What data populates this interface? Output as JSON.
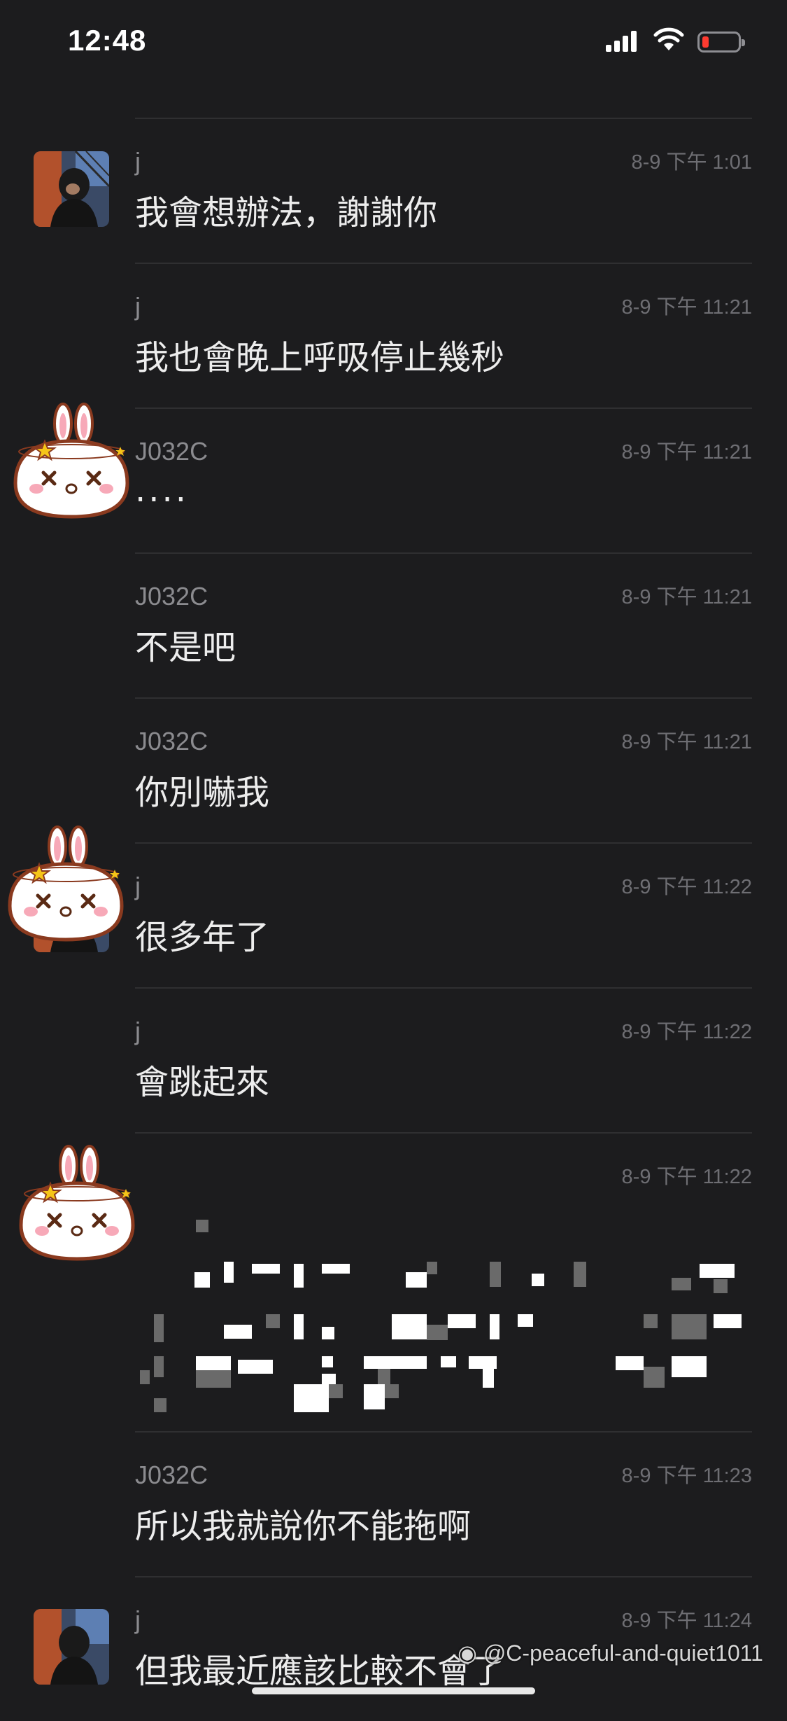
{
  "status_bar": {
    "time": "12:48",
    "battery": "low"
  },
  "messages": [
    {
      "sender": "j",
      "timestamp": "8-9 下午 1:01",
      "text": "我會想辦法，謝謝你",
      "avatar": "photo"
    },
    {
      "sender": "j",
      "timestamp": "8-9 下午 11:21",
      "text": "我也會晚上呼吸停止幾秒"
    },
    {
      "sender": "J032C",
      "timestamp": "8-9 下午 11:21",
      "text": "...."
    },
    {
      "sender": "J032C",
      "timestamp": "8-9 下午 11:21",
      "text": "不是吧"
    },
    {
      "sender": "J032C",
      "timestamp": "8-9 下午 11:21",
      "text": "你別嚇我"
    },
    {
      "sender": "j",
      "timestamp": "8-9 下午 11:22",
      "text": "很多年了"
    },
    {
      "sender": "j",
      "timestamp": "8-9 下午 11:22",
      "text": "會跳起來"
    },
    {
      "sender": "",
      "timestamp": "8-9 下午 11:22",
      "text": ""
    },
    {
      "sender": "J032C",
      "timestamp": "8-9 下午 11:23",
      "text": "所以我就說你不能拖啊"
    },
    {
      "sender": "j",
      "timestamp": "8-9 下午 11:24",
      "text": "但我最近應該比較不會了"
    }
  ],
  "watermark": "@C-peaceful-and-quiet1011",
  "colors": {
    "background": "#1c1c1e",
    "text": "#ededed",
    "sender": "#8b8b8f",
    "timestamp": "#6e6e73"
  }
}
